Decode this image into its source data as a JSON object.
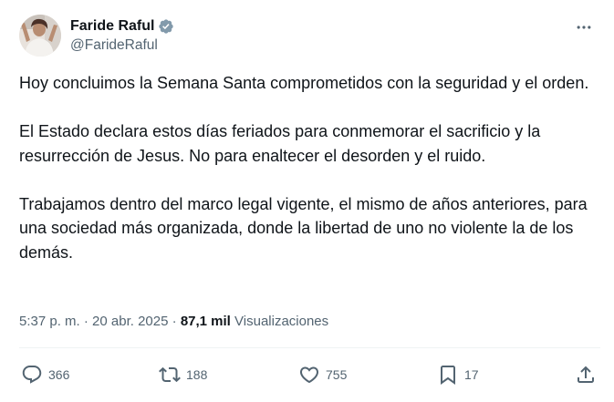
{
  "author": {
    "display_name": "Faride Raful",
    "handle": "@FarideRaful",
    "avatar_icon": "profile-photo",
    "verified_icon": "verified-badge-icon",
    "verified_color": "#829aab"
  },
  "menu": {
    "icon": "more-horizontal-icon"
  },
  "post": {
    "paragraphs": [
      "Hoy concluimos la Semana Santa comprometidos con la seguridad y el orden.",
      "El Estado declara estos días feriados para conmemorar el sacrificio y la resurrección de Jesus. No para enaltecer el desorden y el ruido.",
      "Trabajamos dentro del marco legal vigente, el mismo de años anteriores, para una sociedad más organizada, donde la libertad de uno no violente la de los demás."
    ]
  },
  "meta": {
    "time": "5:37 p. m.",
    "separator": "·",
    "date": "20 abr. 2025",
    "views_count": "87,1 mil",
    "views_label": "Visualizaciones"
  },
  "actions": {
    "replies": {
      "icon": "reply-icon",
      "count": "366"
    },
    "reposts": {
      "icon": "repost-icon",
      "count": "188"
    },
    "likes": {
      "icon": "like-icon",
      "count": "755"
    },
    "bookmarks": {
      "icon": "bookmark-icon",
      "count": "17"
    },
    "share": {
      "icon": "share-icon"
    }
  },
  "colors": {
    "text_primary": "#0f1419",
    "text_secondary": "#536471",
    "divider": "#eff3f4"
  }
}
